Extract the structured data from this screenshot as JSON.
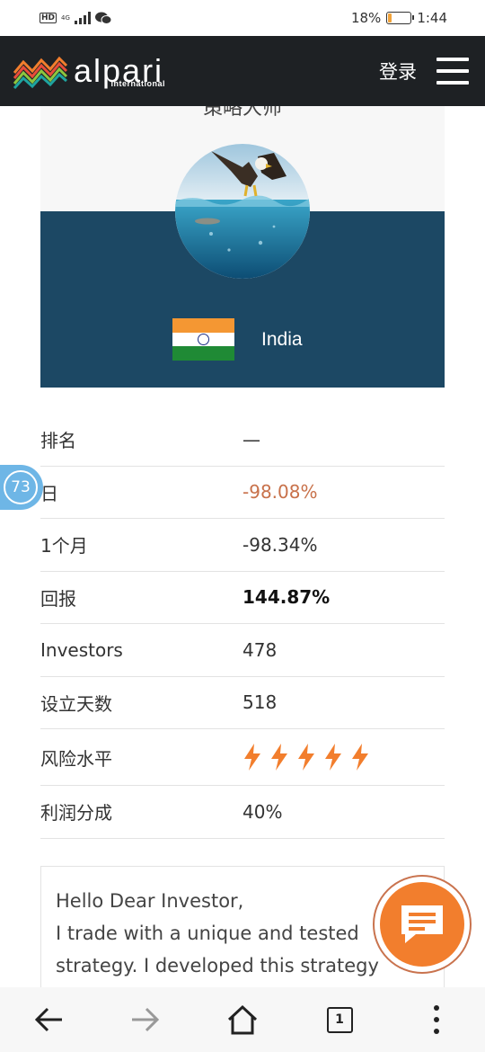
{
  "status_bar": {
    "hd": "HD",
    "network": "4G",
    "battery_percent": "18%",
    "battery_level": 0.18,
    "time": "1:44"
  },
  "header": {
    "brand_name": "alpari",
    "brand_sub": "international",
    "login_label": "登录"
  },
  "profile": {
    "title": "策略大师",
    "country": "India"
  },
  "stats": {
    "rows": [
      {
        "label": "排名",
        "value": "—"
      },
      {
        "label": "日",
        "value": "-98.08%"
      },
      {
        "label": "1个月",
        "value": "-98.34%"
      },
      {
        "label": "回报",
        "value": "144.87%"
      },
      {
        "label": "Investors",
        "value": "478"
      },
      {
        "label": "设立天数",
        "value": "518"
      },
      {
        "label": "风险水平",
        "risk_level": 5
      },
      {
        "label": "利润分成",
        "value": "40%"
      }
    ]
  },
  "bubble": {
    "count": "73"
  },
  "description": {
    "lines": [
      "Hello Dear Investor,",
      "I trade with a unique and tested",
      "strategy. I developed this strategy"
    ]
  },
  "nav": {
    "tab_count": "1"
  },
  "colors": {
    "header_bg": "#1e2124",
    "card_blue": "#1c4864",
    "accent_orange": "#f27e2d",
    "negative": "#c8714a",
    "bubble_blue": "#6eb6e6"
  }
}
